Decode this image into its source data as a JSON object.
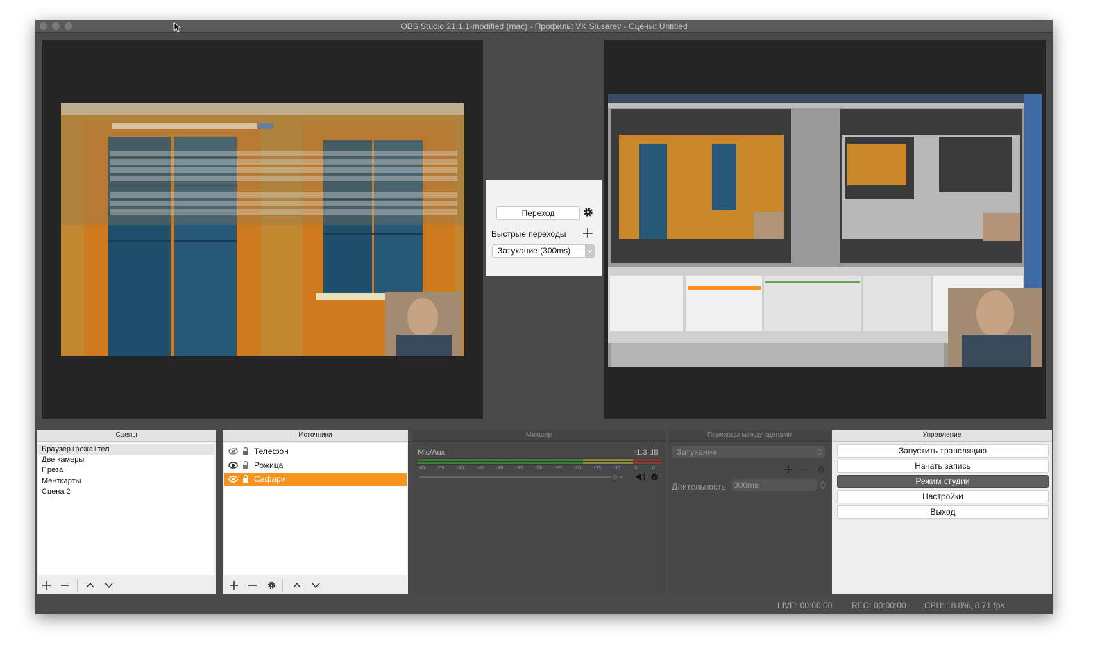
{
  "window": {
    "title": "OBS Studio 21.1.1-modified (mac) - Профиль: VK Slusarev - Сцены: Untitled"
  },
  "transition_panel": {
    "transition_button": "Переход",
    "quick_transitions_label": "Быстрые переходы",
    "transition_select": "Затухание (300ms)"
  },
  "scenes": {
    "title": "Сцены",
    "items": [
      "Браузер+рожа+тел",
      "Две камеры",
      "Преза",
      "Менткарты",
      "Сцена 2"
    ],
    "selected_index": 0
  },
  "sources": {
    "title": "Источники",
    "items": [
      {
        "label": "Телефон",
        "visible": false
      },
      {
        "label": "Рожица",
        "visible": true
      },
      {
        "label": "Сафари",
        "visible": true
      }
    ],
    "selected_index": 2
  },
  "mixer": {
    "title": "Микшер",
    "channel_name": "Mic/Aux",
    "level": "-1.3 dB",
    "ticks": [
      "-60",
      "-55",
      "-50",
      "-45",
      "-40",
      "-35",
      "-30",
      "-25",
      "-20",
      "-15",
      "-10",
      "-5",
      "0"
    ],
    "volume_fraction": 0.96
  },
  "scene_transitions": {
    "title": "Переходы между сценами",
    "selected": "Затухание",
    "duration_label": "Длительность",
    "duration_value": "300ms"
  },
  "controls": {
    "title": "Управление",
    "buttons": [
      "Запустить трансляцию",
      "Начать запись",
      "Режим студии",
      "Настройки",
      "Выход"
    ],
    "active_index": 2
  },
  "status": {
    "live": "LIVE: 00:00:00",
    "rec": "REC: 00:00:00",
    "cpu": "CPU: 18.8%, 8.71 fps"
  },
  "colors": {
    "accent": "#f7941d",
    "window_bg": "#4a4a4a",
    "preview_bg": "#242424"
  }
}
